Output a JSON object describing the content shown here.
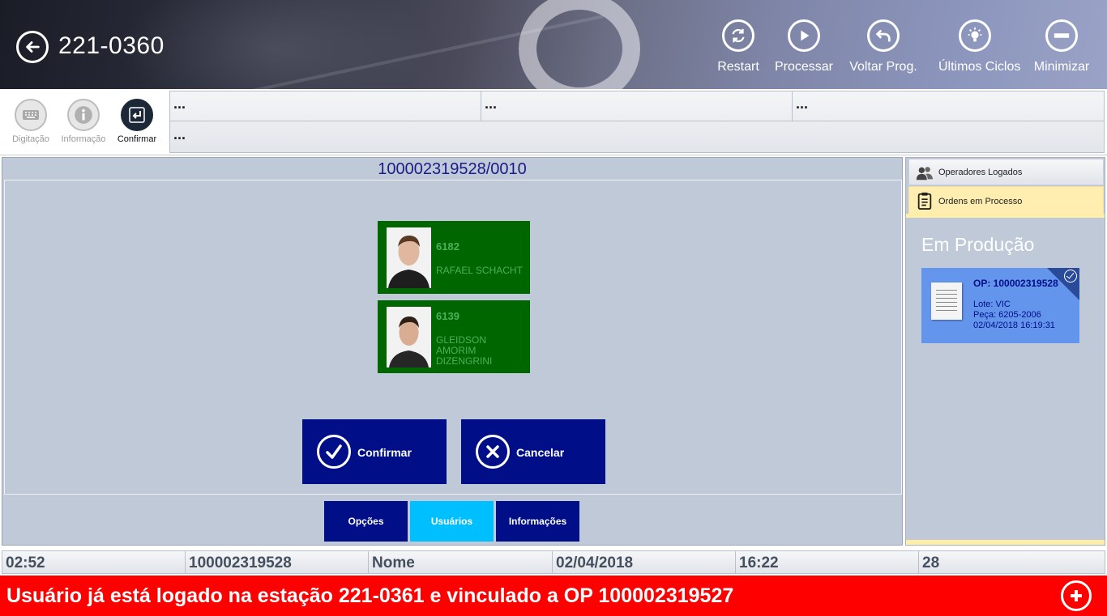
{
  "header": {
    "station": "221-0360",
    "buttons": [
      {
        "label": "Restart",
        "icon": "restart-icon"
      },
      {
        "label": "Processar",
        "icon": "play-icon"
      },
      {
        "label": "Voltar Prog.",
        "icon": "undo-icon"
      },
      {
        "label": "Últimos Ciclos",
        "icon": "lightbulb-icon"
      },
      {
        "label": "Minimizar",
        "icon": "minus-icon"
      }
    ]
  },
  "toolbar": {
    "buttons": [
      {
        "label": "Digitação",
        "icon": "keyboard-icon",
        "enabled": false
      },
      {
        "label": "Informação",
        "icon": "info-icon",
        "enabled": false
      },
      {
        "label": "Confirmar",
        "icon": "enter-icon",
        "enabled": true
      }
    ],
    "info_cells": [
      "...",
      "...",
      "...",
      "..."
    ]
  },
  "main": {
    "order_title": "100002319528/0010",
    "operators": [
      {
        "code": "6182",
        "name": "RAFAEL SCHACHT"
      },
      {
        "code": "6139",
        "name": "GLEIDSON AMORIM DIZENGRINI"
      }
    ],
    "confirm_label": "Confirmar",
    "cancel_label": "Cancelar",
    "tabs": [
      {
        "label": "Opções",
        "selected": false
      },
      {
        "label": "Usuários",
        "selected": true
      },
      {
        "label": "Informações",
        "selected": false
      }
    ]
  },
  "right_panel": {
    "tabs": [
      {
        "label": "Operadores Logados",
        "icon": "users-icon",
        "selected": false
      },
      {
        "label": "Ordens em Processo",
        "icon": "clipboard-icon",
        "selected": true
      }
    ],
    "section_title": "Em Produção",
    "order_tile": {
      "op": "OP: 100002319528",
      "lote": "Lote: VIC",
      "peca": "Peça: 6205-2006",
      "datetime": "02/04/2018 16:19:31"
    }
  },
  "status_bar": [
    "02:52",
    "100002319528",
    "Nome",
    "02/04/2018",
    "16:22",
    "28"
  ],
  "alert": {
    "message": "Usuário já está logado na estação 221-0361 e vinculado a OP 100002319527"
  },
  "colors": {
    "brand_blue": "#000e88",
    "accent_cyan": "#00bfff",
    "card_green": "#006600",
    "alert_red": "#ff0000",
    "tile_blue": "#6495ed"
  }
}
